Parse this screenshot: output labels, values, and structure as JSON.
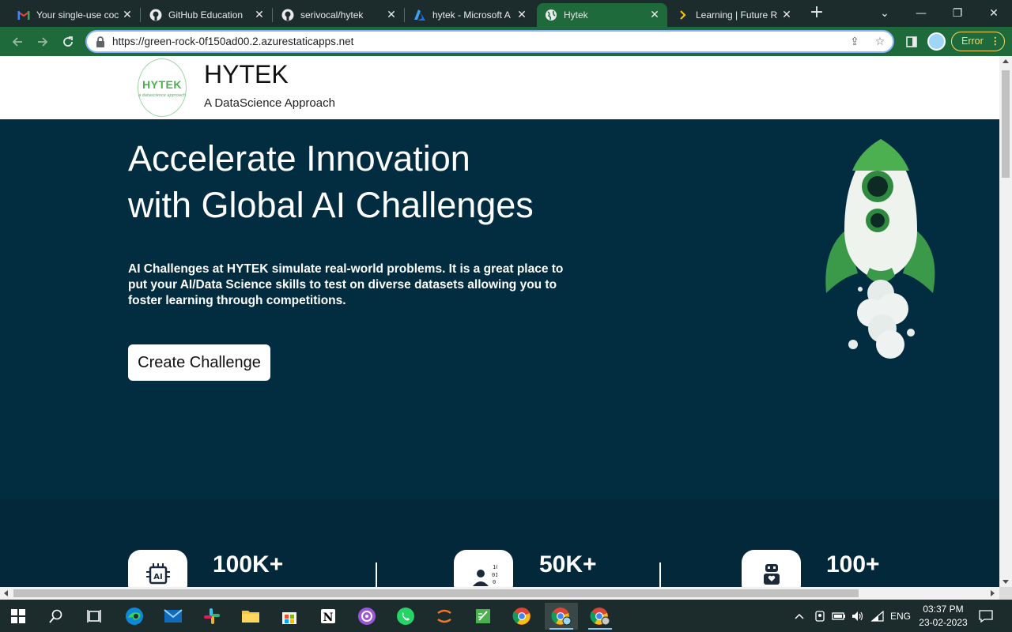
{
  "browser": {
    "tabs": [
      {
        "title": "Your single-use coc",
        "favicon": "gmail-icon"
      },
      {
        "title": "GitHub Education",
        "favicon": "github-icon"
      },
      {
        "title": "serivocal/hytek",
        "favicon": "github-icon"
      },
      {
        "title": "hytek - Microsoft A",
        "favicon": "azure-icon"
      },
      {
        "title": "Hytek",
        "favicon": "globe-icon",
        "active": true
      },
      {
        "title": "Learning | Future R",
        "favicon": "future-icon"
      }
    ],
    "url": "https://green-rock-0f150ad00.2.azurestaticapps.net",
    "error_label": "Error"
  },
  "site": {
    "logo_text": "HYTEK",
    "logo_subtext": "a datascience approach",
    "brand_name": "HYTEK",
    "tagline": "A DataScience Approach"
  },
  "hero": {
    "title_line1": "Accelerate Innovation",
    "title_line2": "with Global AI Challenges",
    "description": "AI Challenges at HYTEK simulate real-world problems. It is a great place to put your AI/Data Science skills to test on diverse datasets allowing you to foster learning through competitions.",
    "cta_label": "Create Challenge"
  },
  "stats": [
    {
      "value": "100K+",
      "icon": "ai-chip-icon"
    },
    {
      "value": "50K+",
      "icon": "data-scientist-icon"
    },
    {
      "value": "100+",
      "icon": "robot-icon"
    }
  ],
  "taskbar": {
    "apps": [
      "start-icon",
      "search-icon",
      "task-view-icon",
      "edge-icon",
      "mail-icon",
      "slack-icon",
      "file-explorer-icon",
      "store-icon",
      "notion-icon",
      "podcast-icon",
      "whatsapp-icon",
      "jupyter-icon",
      "notepad-icon",
      "chrome-icon",
      "chrome-profile-icon",
      "chrome-dev-icon"
    ],
    "language": "ENG",
    "time": "03:37 PM",
    "date": "23-02-2023"
  },
  "colors": {
    "browser_frame": "#1c2b2b",
    "toolbar": "#1e6a3a",
    "hero_bg": "#022d40",
    "brand_green": "#4caf50",
    "error_yellow": "#fdd663"
  }
}
